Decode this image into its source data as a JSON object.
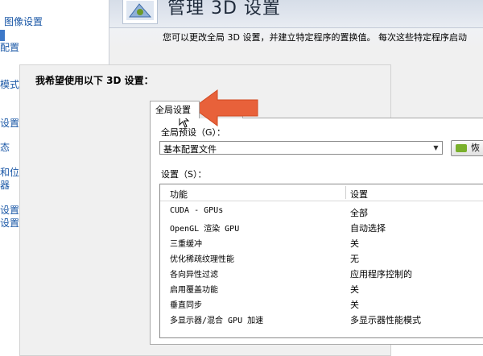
{
  "sidebar": {
    "items": [
      {
        "label": "图像设置"
      },
      {
        "label": ""
      },
      {
        "label": "配置"
      },
      {
        "label": ""
      },
      {
        "label": "模式"
      },
      {
        "label": "设置"
      },
      {
        "label": "态"
      },
      {
        "label": "和位置"
      },
      {
        "label": "器"
      },
      {
        "label": "设置"
      },
      {
        "label": "设置"
      }
    ]
  },
  "header": {
    "title": "管理 3D 设置"
  },
  "main": {
    "description": "您可以更改全局 3D 设置，并建立特定程序的置换值。 每次这些特定程序启动",
    "section_heading": "我希望使用以下 3D 设置：",
    "tabs": [
      {
        "label": "全局设置",
        "active": true
      },
      {
        "label": "",
        "active": false
      }
    ],
    "preset_label": "全局预设（G）：",
    "preset_value": "基本配置文件",
    "restore_label": "恢",
    "settings_label": "设置（S）：",
    "table": {
      "columns": [
        "功能",
        "设置"
      ],
      "rows": [
        {
          "feature": "CUDA - GPUs",
          "value": "全部"
        },
        {
          "feature": "OpenGL 渲染 GPU",
          "value": "自动选择"
        },
        {
          "feature": "三重缓冲",
          "value": "关"
        },
        {
          "feature": "优化稀疏纹理性能",
          "value": "无"
        },
        {
          "feature": "各向异性过滤",
          "value": "应用程序控制的"
        },
        {
          "feature": "启用覆盖功能",
          "value": "关"
        },
        {
          "feature": "垂直同步",
          "value": "关"
        },
        {
          "feature": "多显示器/混合 GPU 加速",
          "value": "多显示器性能模式"
        },
        {
          "feature": "",
          "value": ""
        }
      ]
    }
  },
  "colors": {
    "accent_link": "#1a57a6",
    "arrow": "#e8613a",
    "restore_icon": "#7ab02c"
  }
}
